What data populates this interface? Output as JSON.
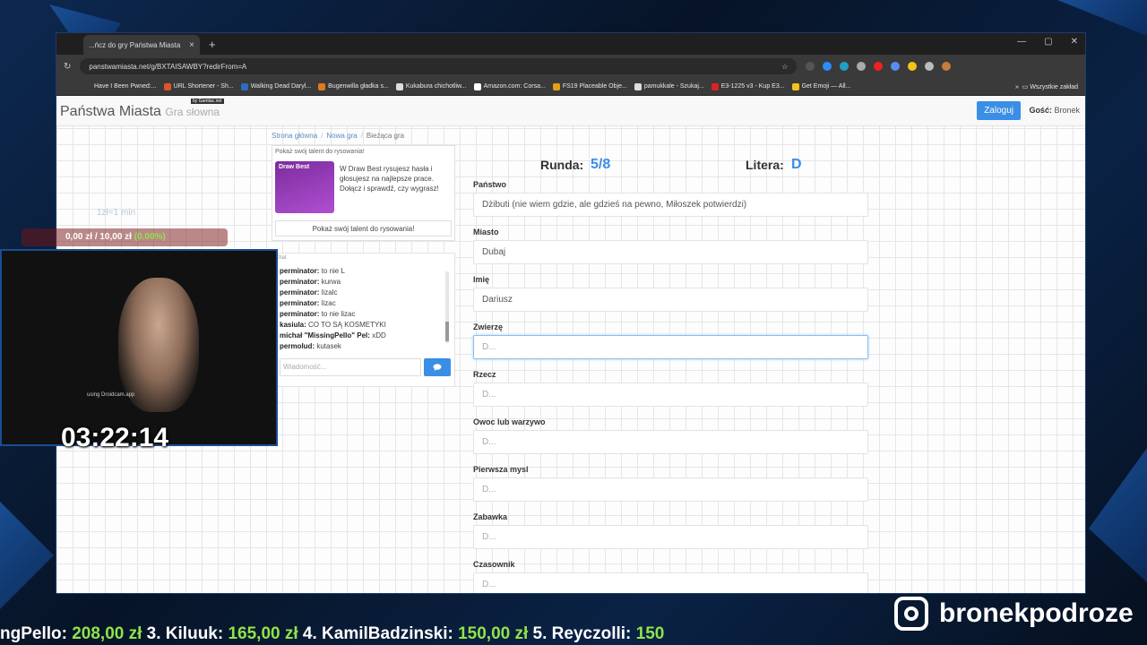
{
  "browser": {
    "tab_title": "...ńcz do gry Państwa Miasta",
    "url": "panstwamiasta.net/g/BXTAISAWBY?redirFrom=A",
    "bookmarks": [
      "Have I Been Pwned:...",
      "URL Shortener - Sh...",
      "Walking Dead Daryl...",
      "Bugenwilla gładka s...",
      "Kukabura chichotliw...",
      "Amazon.com: Corsa...",
      "FS19 Placeable Obje...",
      "pamukkale - Szukaj...",
      "E3-1225 v3 - Kup E3...",
      "Get Emoji — All..."
    ],
    "bookmarks_more": "Wszystkie zakład"
  },
  "site": {
    "brand": "Państwa Miasta",
    "brand_sub": "Gra słowna",
    "brand_by": "by Gamtac.net",
    "login_label": "Zaloguj",
    "guest_label": "Gość:",
    "guest_name": "Bronek"
  },
  "breadcrumb": {
    "home": "Strona główna",
    "new_game": "Nowa gra",
    "current": "Bieżąca gra"
  },
  "promo": {
    "title": "Pokaż swój talent do rysowania!",
    "image_label": "Draw Best",
    "text": "W Draw Best rysujesz hasła i głosujesz na najlepsze prace. Dołącz i sprawdź, czy wygrasz!",
    "button": "Pokaż swój talent do rysowania!"
  },
  "chat": {
    "label": "Chat",
    "messages": [
      {
        "user": "perminator:",
        "text": "to nie L"
      },
      {
        "user": "perminator:",
        "text": "kurwa"
      },
      {
        "user": "perminator:",
        "text": "lizalc"
      },
      {
        "user": "perminator:",
        "text": "lizac"
      },
      {
        "user": "perminator:",
        "text": "to nie lizac"
      },
      {
        "user": "kasiula:",
        "text": "CO TO SĄ KOSMETYKI"
      },
      {
        "user": "michał \"MissingPello\" Pel:",
        "text": "xDD"
      },
      {
        "user": "permolud:",
        "text": "kutasek"
      }
    ],
    "input_placeholder": "Wiadomość..."
  },
  "game": {
    "round_label": "Runda:",
    "round_value": "5/8",
    "letter_label": "Litera:",
    "letter_value": "D",
    "fields": [
      {
        "label": "Państwo",
        "value": "Dżibuti (nie wiem gdzie, ale gdzieś na pewno, Miłoszek potwierdzi)"
      },
      {
        "label": "Miasto",
        "value": "Dubaj"
      },
      {
        "label": "Imię",
        "value": "Dariusz"
      },
      {
        "label": "Zwierzę",
        "placeholder": "D..."
      },
      {
        "label": "Rzecz",
        "placeholder": "D..."
      },
      {
        "label": "Owoc lub warzywo",
        "placeholder": "D..."
      },
      {
        "label": "Pierwsza mysl",
        "placeholder": "D..."
      },
      {
        "label": "Zabawka",
        "placeholder": "D..."
      },
      {
        "label": "Czasownik",
        "placeholder": "D..."
      }
    ]
  },
  "stream": {
    "timer": "03:22:14",
    "rate": "1zł=1 min",
    "donation_current": "0,00 zł",
    "donation_sep": "/",
    "donation_goal": "10,00 zł",
    "donation_pct": "(0.00%)",
    "webcam_note": "using Droidcam.app",
    "instagram": "bronekpodroze",
    "ticker": [
      {
        "text": "ngPello:",
        "type": "name"
      },
      {
        "text": " 208,00 zł",
        "type": "amount"
      },
      {
        "text": " 3. Kiluuk:",
        "type": "name"
      },
      {
        "text": " 165,00 zł",
        "type": "amount"
      },
      {
        "text": " 4. KamilBadzinski:",
        "type": "name"
      },
      {
        "text": " 150,00 zł",
        "type": "amount"
      },
      {
        "text": " 5. Reyczolli:",
        "type": "name"
      },
      {
        "text": " 150",
        "type": "amount"
      }
    ]
  }
}
